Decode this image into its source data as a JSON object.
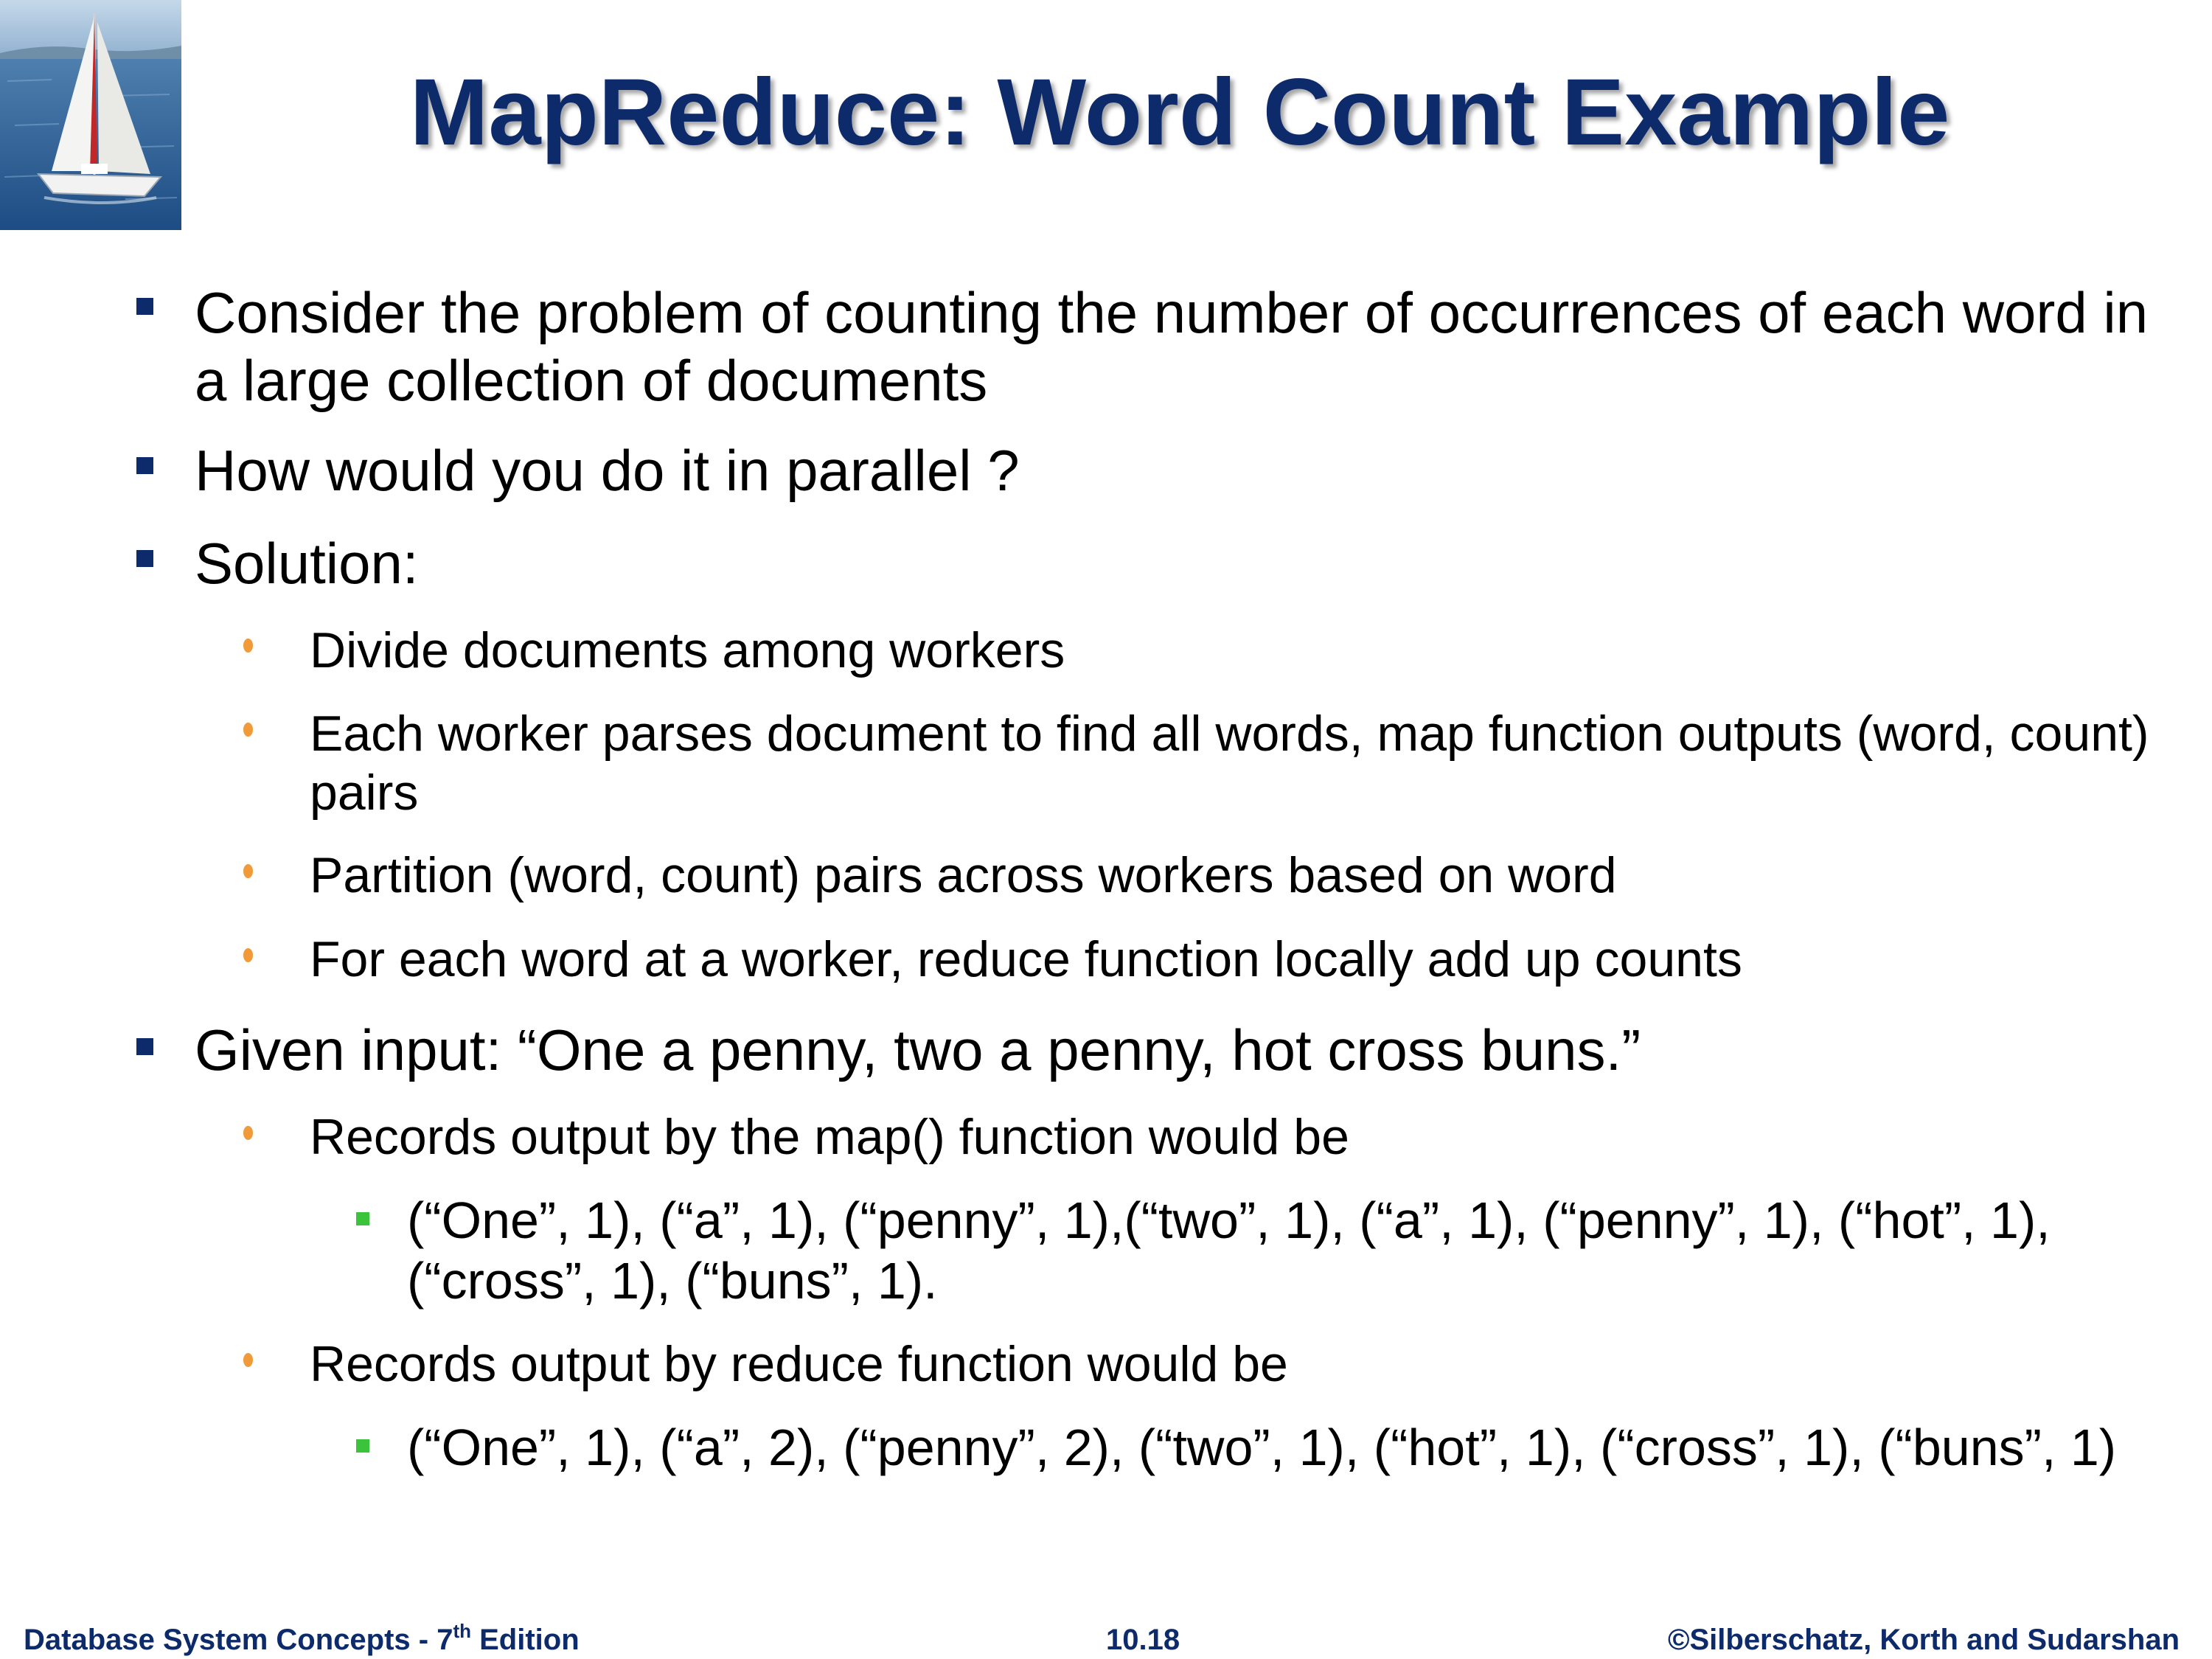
{
  "slide": {
    "title": "MapReduce: Word Count Example",
    "bullets": [
      {
        "text": "Consider the problem of counting the number of occurrences of each word in a large collection of documents"
      },
      {
        "text": "How would you do it in parallel ?"
      },
      {
        "text": "Solution:",
        "subs": [
          "Divide documents among workers",
          "Each worker parses document to find all words, map function outputs (word, count) pairs",
          "Partition (word, count) pairs across workers based on word",
          "For each word at a worker, reduce function locally add up counts"
        ]
      },
      {
        "text": "Given input:  “One a penny, two a penny, hot cross buns.”",
        "subs": [
          {
            "text": "Records output by the map() function would be",
            "detail": "(“One”, 1), (“a”, 1), (“penny”, 1),(“two”, 1), (“a”, 1), (“penny”, 1), (“hot”, 1), (“cross”, 1), (“buns”, 1)."
          },
          {
            "text": "Records output by reduce function would be",
            "detail": "(“One”, 1), (“a”, 2), (“penny”, 2), (“two”, 1), (“hot”, 1), (“cross”, 1), (“buns”, 1)"
          }
        ]
      }
    ]
  },
  "footer": {
    "left_prefix": "Database System Concepts - 7",
    "left_sup": "th",
    "left_suffix": " Edition",
    "center": "10.18",
    "right": "©Silberschatz, Korth and Sudarshan"
  },
  "colors": {
    "title": "#0d2a6b",
    "level1_bullet": "#0d2a6b",
    "level2_bullet": "#f09a3a",
    "level3_bullet": "#3bc43b"
  },
  "icons": {
    "logo": "sailboat-image"
  }
}
